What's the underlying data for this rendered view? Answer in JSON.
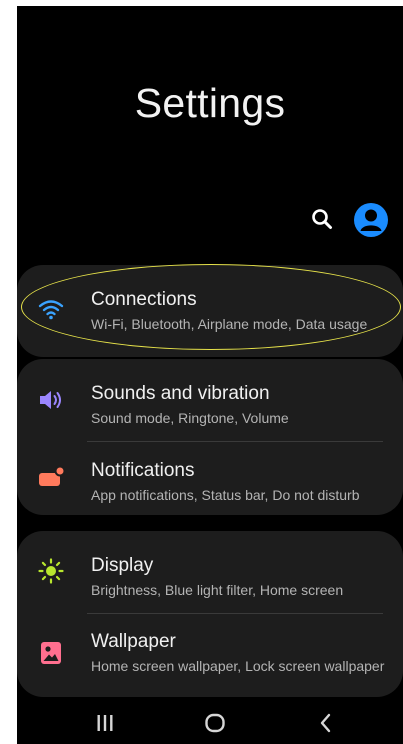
{
  "screen": {
    "title": "Settings"
  },
  "header_icons": [
    "search-icon",
    "account-icon"
  ],
  "colors": {
    "background": "#000000",
    "card": "#1d1d1d",
    "accent": "#1a8cff",
    "highlight": "#e6e24a"
  },
  "items": [
    {
      "title": "Connections",
      "subtitle": "Wi-Fi, Bluetooth, Airplane mode, Data usage",
      "icon": "wifi-icon",
      "icon_color": "#3aa3ff"
    },
    {
      "title": "Sounds and vibration",
      "subtitle": "Sound mode, Ringtone, Volume",
      "icon": "speaker-icon",
      "icon_color": "#9b86ff"
    },
    {
      "title": "Notifications",
      "subtitle": "App notifications, Status bar, Do not disturb",
      "icon": "notification-icon",
      "icon_color": "#ff7a5c"
    },
    {
      "title": "Display",
      "subtitle": "Brightness, Blue light filter, Home screen",
      "icon": "sun-icon",
      "icon_color": "#b8e62e"
    },
    {
      "title": "Wallpaper",
      "subtitle": "Home screen wallpaper, Lock screen wallpaper",
      "icon": "wallpaper-icon",
      "icon_color": "#ff6f8f"
    }
  ],
  "nav": [
    "recents-icon",
    "home-icon",
    "back-icon"
  ]
}
